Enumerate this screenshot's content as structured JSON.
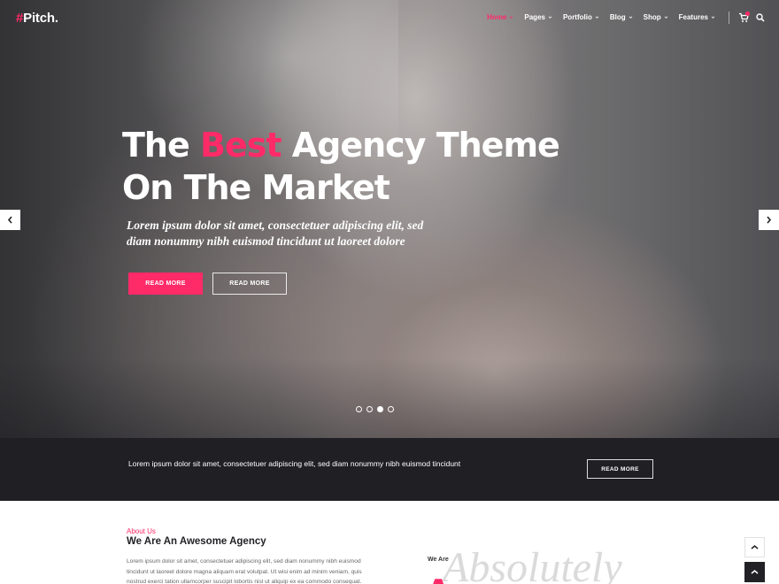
{
  "brand": {
    "logo_hash": "#",
    "logo_text": "Pitch."
  },
  "nav": {
    "items": [
      {
        "label": "Home"
      },
      {
        "label": "Pages"
      },
      {
        "label": "Portfolio"
      },
      {
        "label": "Blog"
      },
      {
        "label": "Shop"
      },
      {
        "label": "Features"
      }
    ],
    "active_item": "Home",
    "cart_icon": "cart-icon",
    "search_icon": "search-icon"
  },
  "hero": {
    "title_part1": "The ",
    "title_accent": "Best",
    "title_part2": " Agency Theme",
    "title_line2": "On The Market",
    "subtitle": "Lorem ipsum dolor sit amet, consectetuer adipiscing elit, sed diam nonummy nibh euismod tincidunt ut laoreet dolore",
    "primary_button": "READ MORE",
    "secondary_button": "READ MORE",
    "slides_total": 4,
    "active_slide": 3
  },
  "cta": {
    "text": "Lorem ipsum dolor sit amet, consectetuer adipiscing elit, sed diam nonummy nibh euismod tincidunt",
    "button": "READ MORE"
  },
  "about": {
    "eyebrow": "About Us",
    "title": "We Are An Awesome Agency",
    "body": "Lorem ipsum dolor sit amet, consectetuer adipiscing elit, sed diam nonummy nibh euismod tincidunt ut laoreet dolore magna aliquam erat volutpat. Ut wisi enim ad minim veniam, quis nostrud exerci tation ullamcorper suscipit lobortis nisl ut aliquip ex ea commodo consequat.",
    "we_are": "We Are",
    "script_word": "Absolutely",
    "pink_word": "Awesome"
  },
  "colors": {
    "accent": "#ff2a68",
    "dark_bar": "#1f1f24"
  }
}
